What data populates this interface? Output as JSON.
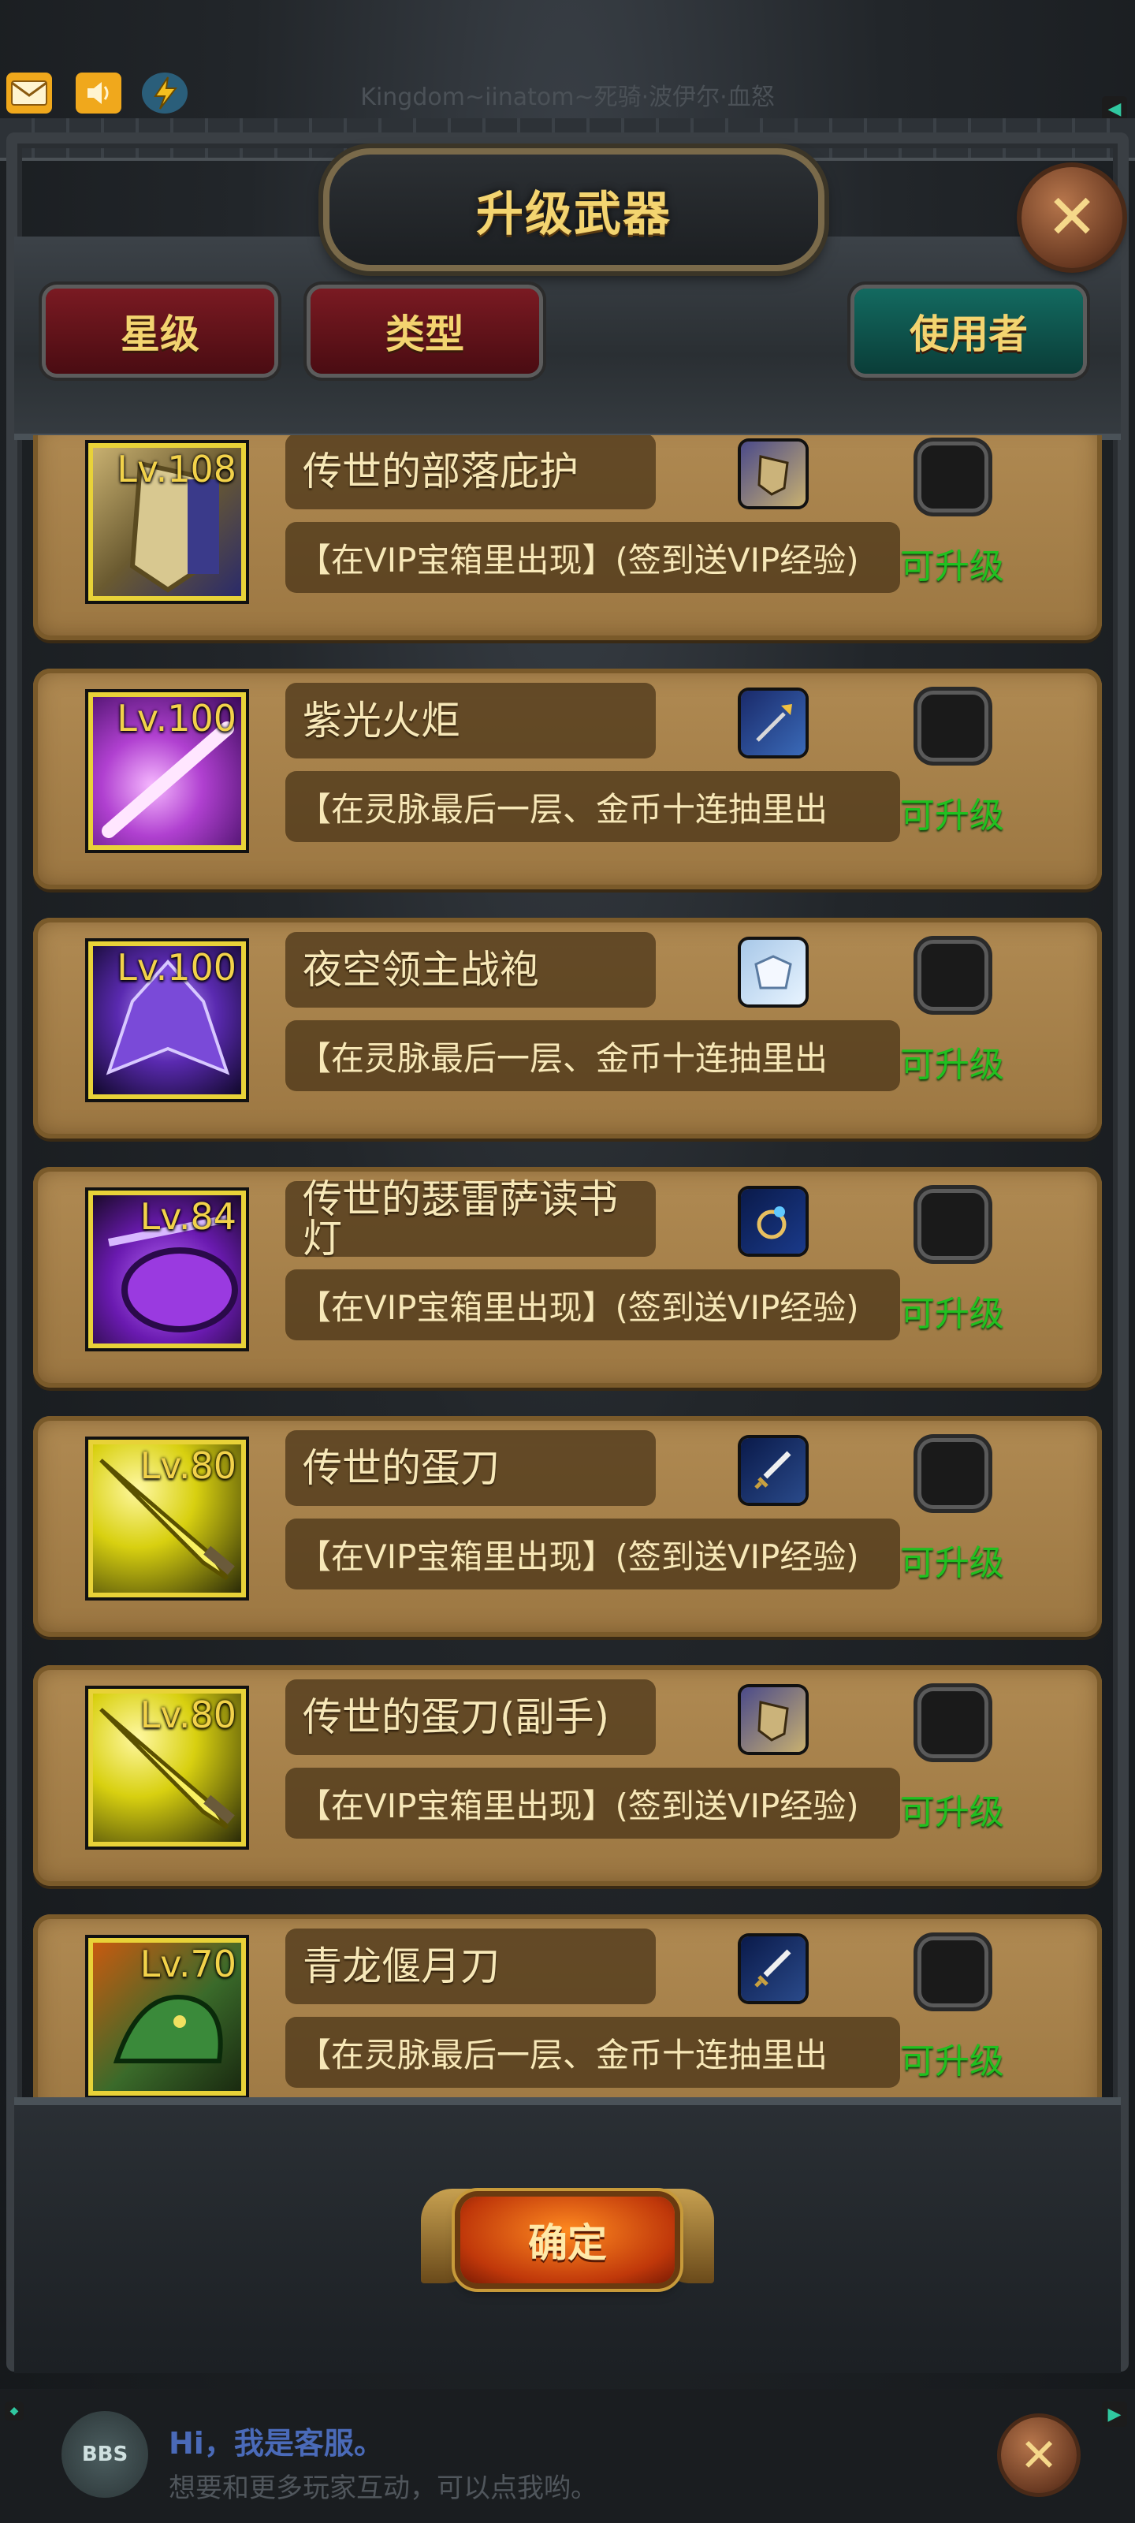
{
  "status_bar": {
    "server_title": "Kingdom~iinatom~死骑·波伊尔·血怒",
    "icons": [
      "mail-icon",
      "speaker-icon",
      "lightning-icon"
    ]
  },
  "window": {
    "title": "升级武器",
    "close_glyph": "✕"
  },
  "filters": {
    "star": "星级",
    "type": "类型",
    "user": "使用者"
  },
  "items": [
    {
      "level": "Lv.108",
      "name": "传世的部落庇护",
      "source": "【在VIP宝箱里出现】(签到送VIP经验)",
      "type_icon": "shield-icon",
      "status": "可升级"
    },
    {
      "level": "Lv.100",
      "name": "紫光火炬",
      "source": "【在灵脉最后一层、金币十连抽里出",
      "type_icon": "spear-icon",
      "status": "可升级"
    },
    {
      "level": "Lv.100",
      "name": "夜空领主战袍",
      "source": "【在灵脉最后一层、金币十连抽里出",
      "type_icon": "armor-icon",
      "status": "可升级"
    },
    {
      "level": "Lv.84",
      "name": "传世的瑟雷萨读书灯",
      "source": "【在VIP宝箱里出现】(签到送VIP经验)",
      "type_icon": "ring-icon",
      "status": "可升级"
    },
    {
      "level": "Lv.80",
      "name": "传世的蛋刀",
      "source": "【在VIP宝箱里出现】(签到送VIP经验)",
      "type_icon": "sword-icon",
      "status": "可升级"
    },
    {
      "level": "Lv.80",
      "name": "传世的蛋刀(副手)",
      "source": "【在VIP宝箱里出现】(签到送VIP经验)",
      "type_icon": "shield-icon",
      "status": "可升级"
    },
    {
      "level": "Lv.70",
      "name": "青龙偃月刀",
      "source": "【在灵脉最后一层、金币十连抽里出",
      "type_icon": "sword-icon",
      "status": "可升级"
    }
  ],
  "confirm_label": "确定",
  "bbs": {
    "logo": "BBS",
    "greeting": "Hi，我是客服。",
    "subtitle": "想要和更多玩家互动，可以点我哟。"
  },
  "colors": {
    "gold_text": "#f3d470",
    "upgradable_green": "#20c020",
    "card_bg": "#b08a52",
    "filter_red": "#7a1a22",
    "filter_teal": "#136a60"
  }
}
